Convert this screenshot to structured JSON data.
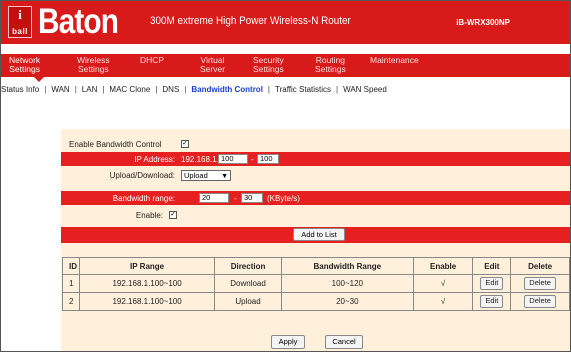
{
  "header": {
    "logo_mark": "i",
    "logo_text": "ball",
    "brand": "Baton",
    "product": "300M extreme High Power Wireless-N Router",
    "model": "iB-WRX300NP",
    "accent_color": "#d81a1a"
  },
  "main_nav": [
    {
      "line1": "Network",
      "line2": "Settings"
    },
    {
      "line1": "Wireless",
      "line2": "Settings"
    },
    {
      "line1": "DHCP",
      "line2": ""
    },
    {
      "line1": "Virtual",
      "line2": "Server"
    },
    {
      "line1": "Security",
      "line2": "Settings"
    },
    {
      "line1": "Routing",
      "line2": "Settings"
    },
    {
      "line1": "Maintenance",
      "line2": ""
    }
  ],
  "sub_nav": {
    "items": [
      "Status Info",
      "WAN",
      "LAN",
      "MAC Clone",
      "DNS",
      "Bandwidth Control",
      "Traffic Statistics",
      "WAN Speed"
    ],
    "separator": "|"
  },
  "form": {
    "enable_bandwidth_control_label": "Enable Bandwidth Control",
    "enable_bandwidth_control_checked": "✓",
    "ip_address_label": "IP Address:",
    "ip_prefix": "192.168.1.",
    "ip_start": "100",
    "ip_dash": "-",
    "ip_end": "100",
    "direction_label": "Upload/Download:",
    "direction_value": "Upload",
    "bandwidth_label": "Bandwidth range:",
    "bw_min": "20",
    "bw_dash": "-",
    "bw_max": "30",
    "bw_unit": "(KByte/s)",
    "enable_label": "Enable:",
    "enable_checked": "✓",
    "add_button": "Add to List"
  },
  "table": {
    "headers": [
      "ID",
      "IP Range",
      "Direction",
      "Bandwidth Range",
      "Enable",
      "Edit",
      "Delete"
    ],
    "rows": [
      {
        "id": "1",
        "ip_range": "192.168.1.100~100",
        "direction": "Download",
        "bandwidth": "100~120",
        "enable": "√",
        "edit": "Edit",
        "delete": "Delete"
      },
      {
        "id": "2",
        "ip_range": "192.168.1.100~100",
        "direction": "Upload",
        "bandwidth": "20~30",
        "enable": "√",
        "edit": "Edit",
        "delete": "Delete"
      }
    ]
  },
  "actions": {
    "apply": "Apply",
    "cancel": "Cancel"
  }
}
